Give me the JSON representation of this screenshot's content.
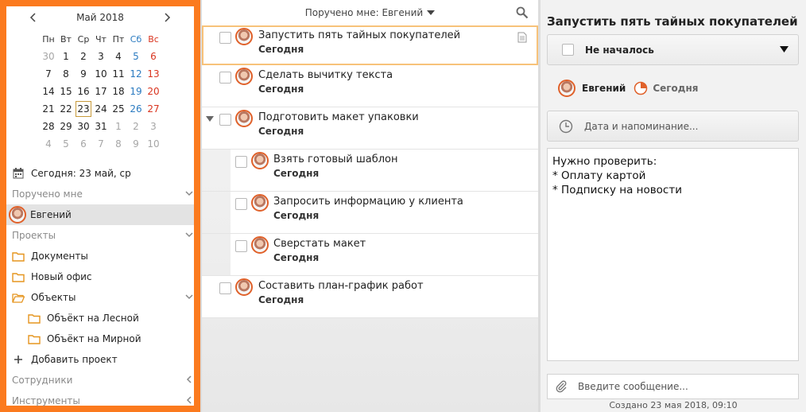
{
  "calendar": {
    "month_title": "Май 2018",
    "weekdays": [
      "Пн",
      "Вт",
      "Ср",
      "Чт",
      "Пт",
      "Сб",
      "Вс"
    ],
    "weeks": [
      [
        {
          "d": "30",
          "o": 1
        },
        {
          "d": "1"
        },
        {
          "d": "2"
        },
        {
          "d": "3"
        },
        {
          "d": "4"
        },
        {
          "d": "5"
        },
        {
          "d": "6"
        }
      ],
      [
        {
          "d": "7"
        },
        {
          "d": "8"
        },
        {
          "d": "9"
        },
        {
          "d": "10"
        },
        {
          "d": "11"
        },
        {
          "d": "12"
        },
        {
          "d": "13"
        }
      ],
      [
        {
          "d": "14"
        },
        {
          "d": "15"
        },
        {
          "d": "16"
        },
        {
          "d": "17"
        },
        {
          "d": "18"
        },
        {
          "d": "19"
        },
        {
          "d": "20"
        }
      ],
      [
        {
          "d": "21"
        },
        {
          "d": "22"
        },
        {
          "d": "23",
          "t": 1
        },
        {
          "d": "24"
        },
        {
          "d": "25"
        },
        {
          "d": "26"
        },
        {
          "d": "27"
        }
      ],
      [
        {
          "d": "28"
        },
        {
          "d": "29"
        },
        {
          "d": "30"
        },
        {
          "d": "31"
        },
        {
          "d": "1",
          "o": 1
        },
        {
          "d": "2",
          "o": 1
        },
        {
          "d": "3",
          "o": 1
        }
      ],
      [
        {
          "d": "4",
          "o": 1
        },
        {
          "d": "5",
          "o": 1
        },
        {
          "d": "6",
          "o": 1
        },
        {
          "d": "7",
          "o": 1
        },
        {
          "d": "8",
          "o": 1
        },
        {
          "d": "9",
          "o": 1
        },
        {
          "d": "10",
          "o": 1
        }
      ]
    ]
  },
  "sidebar": {
    "today_label": "Сегодня: 23 май, ср",
    "assigned_section": "Поручено мне",
    "assigned_user": "Евгений",
    "projects_section": "Проекты",
    "projects": {
      "docs": "Документы",
      "office": "Новый офис",
      "objects": "Объекты",
      "obj_lesnoy": "Объёкт на Лесной",
      "obj_mirnoy": "Объёкт на Мирной"
    },
    "add_project": "Добавить проект",
    "employees_section": "Сотрудники",
    "tools_section": "Инструменты"
  },
  "tasklist": {
    "header": "Поручено мне: Евгений",
    "tasks": [
      {
        "title": "Запустить пять тайных покупателей",
        "due": "Сегодня"
      },
      {
        "title": "Сделать вычитку текста",
        "due": "Сегодня"
      },
      {
        "title": "Подготовить макет упаковки",
        "due": "Сегодня"
      },
      {
        "title": "Взять готовый шаблон",
        "due": "Сегодня"
      },
      {
        "title": "Запросить информацию у клиента",
        "due": "Сегодня"
      },
      {
        "title": "Сверстать макет",
        "due": "Сегодня"
      },
      {
        "title": "Составить план-график работ",
        "due": "Сегодня"
      }
    ]
  },
  "detail": {
    "title": "Запустить пять тайных покупателей",
    "status": "Не началось",
    "assignee": "Евгений",
    "due": "Сегодня",
    "reminder_placeholder": "Дата и напоминание...",
    "notes": "Нужно проверить:\n* Оплату картой\n* Подписку на новости",
    "message_placeholder": "Введите сообщение...",
    "created": "Создано 23 мая 2018, 09:10"
  },
  "colors": {
    "accent": "#fb7a1e",
    "saturday": "#2b7bc1",
    "sunday": "#d9341f",
    "selected_border": "#f7c27a"
  }
}
